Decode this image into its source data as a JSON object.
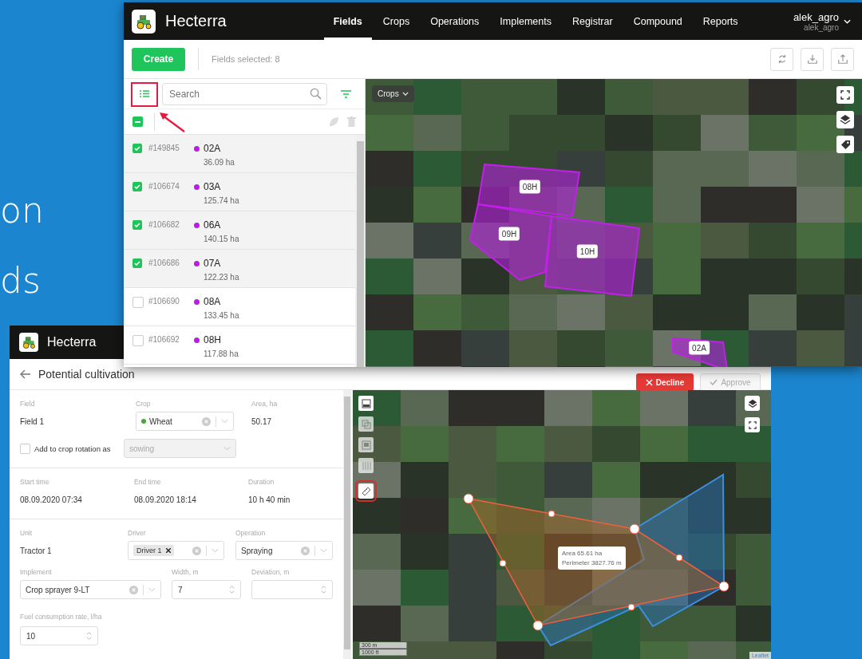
{
  "backdrop_text": [
    "on",
    "ds"
  ],
  "fields_window": {
    "app_name": "Hecterra",
    "nav": [
      {
        "label": "Fields",
        "selected": true
      },
      {
        "label": "Crops",
        "selected": false
      },
      {
        "label": "Operations",
        "selected": false
      },
      {
        "label": "Implements",
        "selected": false
      },
      {
        "label": "Registrar",
        "selected": false
      },
      {
        "label": "Compound",
        "selected": false
      },
      {
        "label": "Reports",
        "selected": false
      }
    ],
    "user": {
      "name": "alek_agro",
      "login": "alek_agro"
    },
    "create_button": "Create",
    "selection_status": "Fields selected: 8",
    "search": {
      "placeholder": "Search"
    },
    "select_all": {
      "indeterminate": true
    },
    "fields": [
      {
        "id": "#149845",
        "name": "02A",
        "area": "36.09 ha",
        "checked": true,
        "color": "#b620e0"
      },
      {
        "id": "#106674",
        "name": "03A",
        "area": "125.74 ha",
        "checked": true,
        "color": "#b620e0"
      },
      {
        "id": "#106682",
        "name": "06A",
        "area": "140.15 ha",
        "checked": true,
        "color": "#b620e0"
      },
      {
        "id": "#106686",
        "name": "07A",
        "area": "122.23 ha",
        "checked": true,
        "color": "#b620e0"
      },
      {
        "id": "#106690",
        "name": "08A",
        "area": "133.45 ha",
        "checked": false,
        "color": "#b620e0"
      },
      {
        "id": "#106692",
        "name": "08H",
        "area": "117.88 ha",
        "checked": false,
        "color": "#b620e0"
      }
    ],
    "map": {
      "layer_dropdown": "Crops",
      "field_labels": [
        "08H",
        "09H",
        "10H",
        "02A"
      ]
    }
  },
  "cultivation_window": {
    "app_name": "Hecterra",
    "title": "Potential cultivation",
    "decline_button": "Decline",
    "approve_button": {
      "label": "Approve",
      "disabled": true
    },
    "field": {
      "label": "Field",
      "value": "Field 1"
    },
    "crop": {
      "label": "Crop",
      "value": "Wheat"
    },
    "area": {
      "label": "Area, ha",
      "value": "50.17"
    },
    "crop_rotation": {
      "label": "Add to crop rotation as",
      "checked": false,
      "value": "sowing",
      "disabled": true
    },
    "times": [
      {
        "label": "Start time",
        "value": "08.09.2020 07:34"
      },
      {
        "label": "End time",
        "value": "08.09.2020 18:14"
      },
      {
        "label": "Duration",
        "value": "10 h 40 min"
      }
    ],
    "unit": {
      "label": "Unit",
      "value": "Tractor 1"
    },
    "driver": {
      "label": "Driver",
      "chips": [
        "Driver 1"
      ]
    },
    "operation": {
      "label": "Operation",
      "value": "Spraying"
    },
    "implement": {
      "label": "Implement",
      "value": "Crop sprayer 9-LT"
    },
    "width": {
      "label": "Width, m",
      "value": "7"
    },
    "deviation": {
      "label": "Deviation, m"
    },
    "fuel_rate": {
      "label": "Fuel consumption rate, l/ha",
      "value": "10"
    },
    "map": {
      "measurement": [
        "Area 65.61 ha",
        "Perimeter 3827.76 m"
      ],
      "scale": [
        "300 m",
        "1000 ft"
      ],
      "attribution": "Leaflet"
    }
  }
}
